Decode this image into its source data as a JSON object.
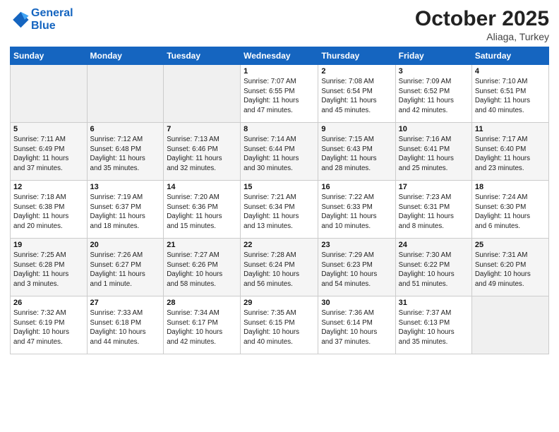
{
  "logo": {
    "line1": "General",
    "line2": "Blue"
  },
  "title": "October 2025",
  "location": "Aliaga, Turkey",
  "days_header": [
    "Sunday",
    "Monday",
    "Tuesday",
    "Wednesday",
    "Thursday",
    "Friday",
    "Saturday"
  ],
  "weeks": [
    [
      {
        "num": "",
        "info": ""
      },
      {
        "num": "",
        "info": ""
      },
      {
        "num": "",
        "info": ""
      },
      {
        "num": "1",
        "info": "Sunrise: 7:07 AM\nSunset: 6:55 PM\nDaylight: 11 hours\nand 47 minutes."
      },
      {
        "num": "2",
        "info": "Sunrise: 7:08 AM\nSunset: 6:54 PM\nDaylight: 11 hours\nand 45 minutes."
      },
      {
        "num": "3",
        "info": "Sunrise: 7:09 AM\nSunset: 6:52 PM\nDaylight: 11 hours\nand 42 minutes."
      },
      {
        "num": "4",
        "info": "Sunrise: 7:10 AM\nSunset: 6:51 PM\nDaylight: 11 hours\nand 40 minutes."
      }
    ],
    [
      {
        "num": "5",
        "info": "Sunrise: 7:11 AM\nSunset: 6:49 PM\nDaylight: 11 hours\nand 37 minutes."
      },
      {
        "num": "6",
        "info": "Sunrise: 7:12 AM\nSunset: 6:48 PM\nDaylight: 11 hours\nand 35 minutes."
      },
      {
        "num": "7",
        "info": "Sunrise: 7:13 AM\nSunset: 6:46 PM\nDaylight: 11 hours\nand 32 minutes."
      },
      {
        "num": "8",
        "info": "Sunrise: 7:14 AM\nSunset: 6:44 PM\nDaylight: 11 hours\nand 30 minutes."
      },
      {
        "num": "9",
        "info": "Sunrise: 7:15 AM\nSunset: 6:43 PM\nDaylight: 11 hours\nand 28 minutes."
      },
      {
        "num": "10",
        "info": "Sunrise: 7:16 AM\nSunset: 6:41 PM\nDaylight: 11 hours\nand 25 minutes."
      },
      {
        "num": "11",
        "info": "Sunrise: 7:17 AM\nSunset: 6:40 PM\nDaylight: 11 hours\nand 23 minutes."
      }
    ],
    [
      {
        "num": "12",
        "info": "Sunrise: 7:18 AM\nSunset: 6:38 PM\nDaylight: 11 hours\nand 20 minutes."
      },
      {
        "num": "13",
        "info": "Sunrise: 7:19 AM\nSunset: 6:37 PM\nDaylight: 11 hours\nand 18 minutes."
      },
      {
        "num": "14",
        "info": "Sunrise: 7:20 AM\nSunset: 6:36 PM\nDaylight: 11 hours\nand 15 minutes."
      },
      {
        "num": "15",
        "info": "Sunrise: 7:21 AM\nSunset: 6:34 PM\nDaylight: 11 hours\nand 13 minutes."
      },
      {
        "num": "16",
        "info": "Sunrise: 7:22 AM\nSunset: 6:33 PM\nDaylight: 11 hours\nand 10 minutes."
      },
      {
        "num": "17",
        "info": "Sunrise: 7:23 AM\nSunset: 6:31 PM\nDaylight: 11 hours\nand 8 minutes."
      },
      {
        "num": "18",
        "info": "Sunrise: 7:24 AM\nSunset: 6:30 PM\nDaylight: 11 hours\nand 6 minutes."
      }
    ],
    [
      {
        "num": "19",
        "info": "Sunrise: 7:25 AM\nSunset: 6:28 PM\nDaylight: 11 hours\nand 3 minutes."
      },
      {
        "num": "20",
        "info": "Sunrise: 7:26 AM\nSunset: 6:27 PM\nDaylight: 11 hours\nand 1 minute."
      },
      {
        "num": "21",
        "info": "Sunrise: 7:27 AM\nSunset: 6:26 PM\nDaylight: 10 hours\nand 58 minutes."
      },
      {
        "num": "22",
        "info": "Sunrise: 7:28 AM\nSunset: 6:24 PM\nDaylight: 10 hours\nand 56 minutes."
      },
      {
        "num": "23",
        "info": "Sunrise: 7:29 AM\nSunset: 6:23 PM\nDaylight: 10 hours\nand 54 minutes."
      },
      {
        "num": "24",
        "info": "Sunrise: 7:30 AM\nSunset: 6:22 PM\nDaylight: 10 hours\nand 51 minutes."
      },
      {
        "num": "25",
        "info": "Sunrise: 7:31 AM\nSunset: 6:20 PM\nDaylight: 10 hours\nand 49 minutes."
      }
    ],
    [
      {
        "num": "26",
        "info": "Sunrise: 7:32 AM\nSunset: 6:19 PM\nDaylight: 10 hours\nand 47 minutes."
      },
      {
        "num": "27",
        "info": "Sunrise: 7:33 AM\nSunset: 6:18 PM\nDaylight: 10 hours\nand 44 minutes."
      },
      {
        "num": "28",
        "info": "Sunrise: 7:34 AM\nSunset: 6:17 PM\nDaylight: 10 hours\nand 42 minutes."
      },
      {
        "num": "29",
        "info": "Sunrise: 7:35 AM\nSunset: 6:15 PM\nDaylight: 10 hours\nand 40 minutes."
      },
      {
        "num": "30",
        "info": "Sunrise: 7:36 AM\nSunset: 6:14 PM\nDaylight: 10 hours\nand 37 minutes."
      },
      {
        "num": "31",
        "info": "Sunrise: 7:37 AM\nSunset: 6:13 PM\nDaylight: 10 hours\nand 35 minutes."
      },
      {
        "num": "",
        "info": ""
      }
    ]
  ]
}
